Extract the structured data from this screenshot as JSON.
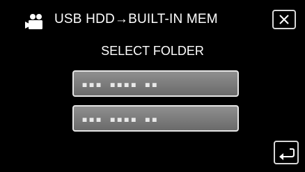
{
  "header": {
    "mode_icon": "video-camera-icon",
    "title": "USB HDD→BUILT-IN MEM",
    "close_icon": "close-icon"
  },
  "screen": {
    "subtitle": "SELECT FOLDER"
  },
  "folders": [
    {
      "name": "▪▪▪ ▪▪▪▪ ▪▪"
    },
    {
      "name": "▪▪▪ ▪▪▪▪ ▪▪"
    }
  ],
  "footer": {
    "back_icon": "return-arrow-icon"
  }
}
